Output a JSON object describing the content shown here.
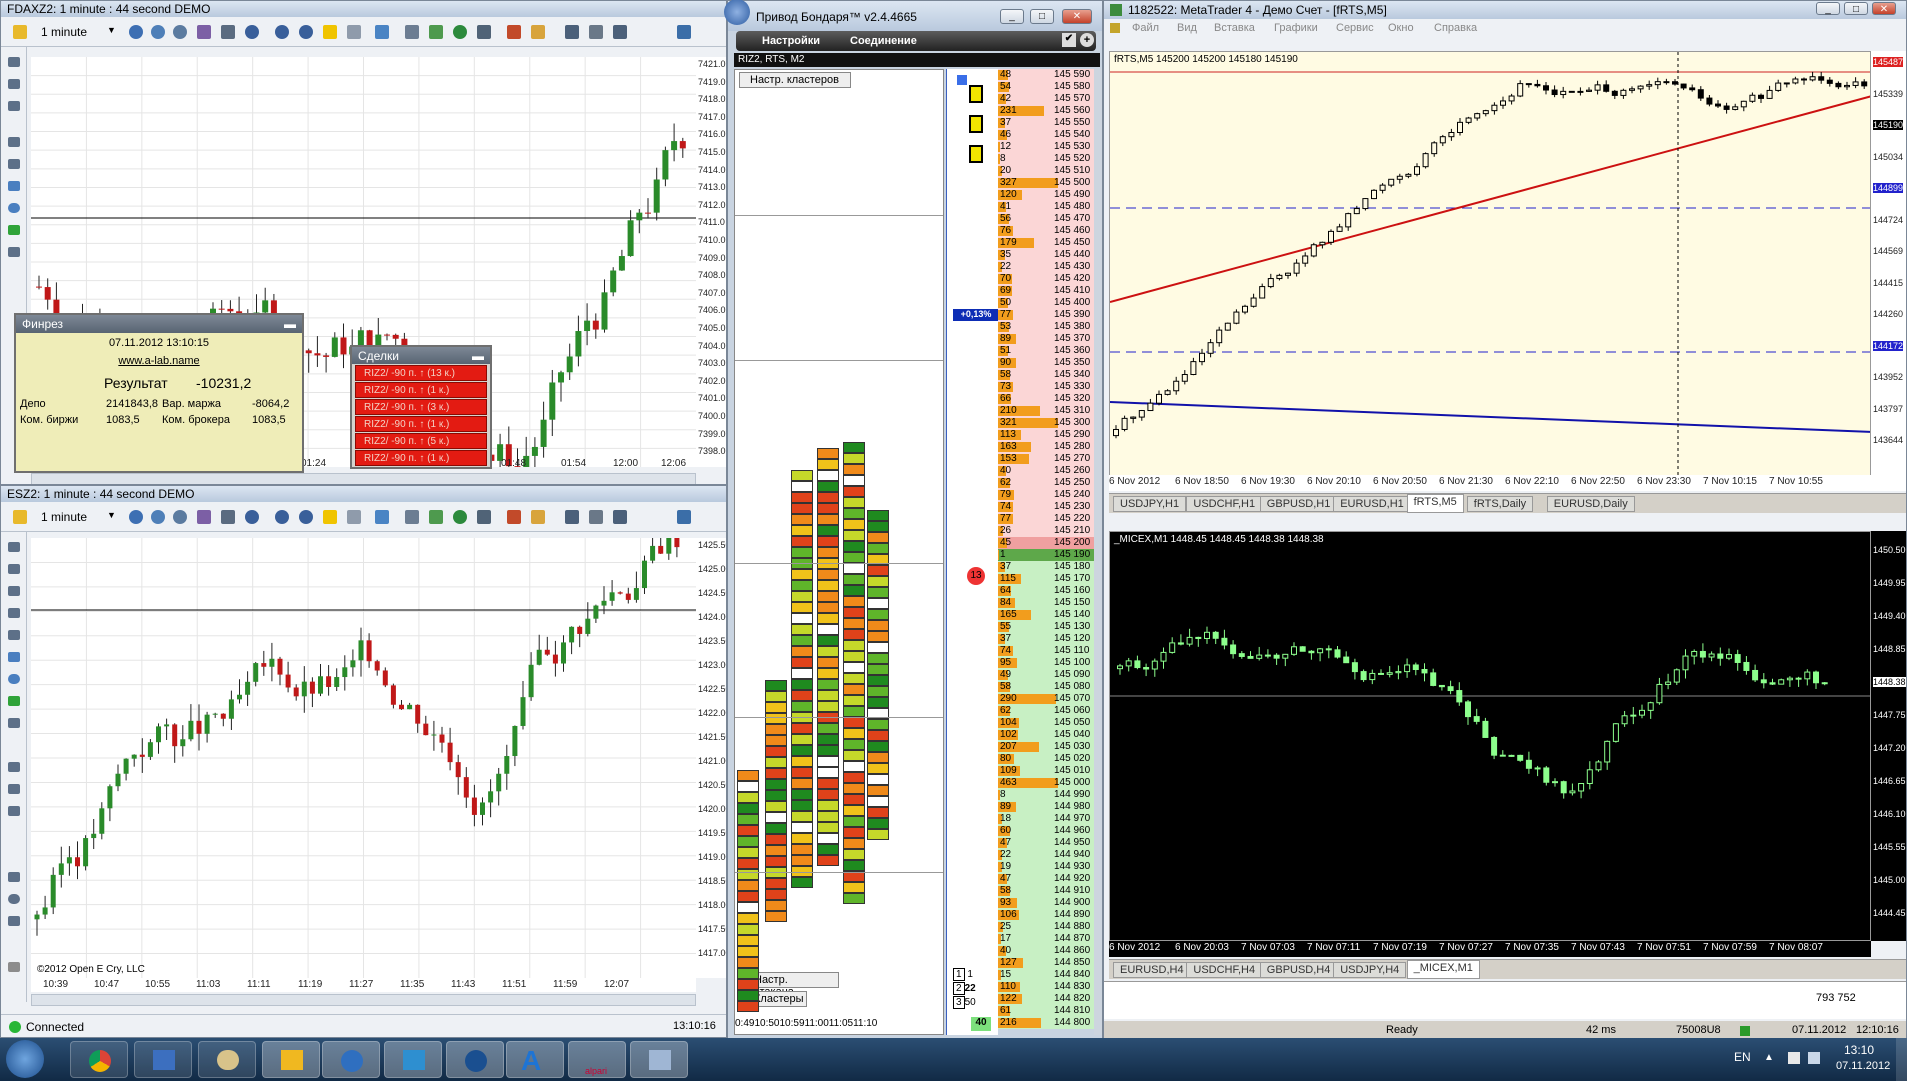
{
  "fdax": {
    "title": "FDAXZ2: 1 minute : 44 second DEMO",
    "timeframe": "1 minute",
    "prices": [
      "7421.0",
      "7419.0",
      "7418.0",
      "7417.0",
      "7416.0",
      "7415.0",
      "7414.0",
      "7413.0",
      "7412.0",
      "7411.0",
      "7410.0",
      "7409.0",
      "7408.0",
      "7407.0",
      "7406.0",
      "7405.0",
      "7404.0",
      "7403.0",
      "7402.0",
      "7401.0",
      "7400.0",
      "7399.0",
      "7398.0"
    ],
    "times": [
      "01:24",
      "01:48",
      "01:54",
      "12:00",
      "12:06"
    ],
    "last": "7412.0"
  },
  "fin": {
    "title": "Финрез",
    "date": "07.11.2012 13:10:15",
    "site": "www.a-lab.name",
    "result_label": "Результат",
    "result_value": "-10231,2",
    "depo_label": "Депо",
    "depo_value": "2141843,8",
    "margin_label": "Вар. маржа",
    "margin_value": "-8064,2",
    "exch_label": "Ком. биржи",
    "exch_value": "1083,5",
    "broker_label": "Ком. брокера",
    "broker_value": "1083,5"
  },
  "deals": {
    "title": "Сделки",
    "rows": [
      "RIZ2/ -90 п. ↑ (13 к.)",
      "RIZ2/ -90 п. ↑ (1 к.)",
      "RIZ2/ -90 п. ↑ (3 к.)",
      "RIZ2/ -90 п. ↑ (1 к.)",
      "RIZ2/ -90 п. ↑ (5 к.)",
      "RIZ2/ -90 п. ↑ (1 к.)"
    ]
  },
  "es": {
    "title": "ESZ2: 1 minute : 44 second DEMO",
    "timeframe": "1 minute",
    "prices": [
      "1425.50",
      "1425.00",
      "1424.50",
      "1424.00",
      "1423.50",
      "1423.00",
      "1422.50",
      "1422.00",
      "1421.50",
      "1421.00",
      "1420.50",
      "1420.00",
      "1419.50",
      "1419.00",
      "1418.50",
      "1418.00",
      "1417.50",
      "1417.00"
    ],
    "times": [
      "10:39",
      "10:47",
      "10:55",
      "11:03",
      "11:11",
      "11:19",
      "11:27",
      "11:35",
      "11:43",
      "11:51",
      "11:59",
      "12:07"
    ],
    "last": "1424.25",
    "copyright": "©2012 Open E Cry, LLC",
    "status": "Connected",
    "clock": "13:10:16"
  },
  "bond": {
    "title": "Привод Бондаря™ v2.4.4665",
    "menu": [
      "Настройки",
      "Соединение"
    ],
    "symbol": "RIZ2, RTS, M2",
    "btn_clusters_settings": "Настр. кластеров",
    "btn_book_settings": "Настр. стакана",
    "btn_clusters": "Кластеры",
    "pct": "+0,13%",
    "trades": "13",
    "legend": [
      [
        "1",
        "1"
      ],
      [
        "2",
        "22"
      ],
      [
        "3",
        "50"
      ]
    ],
    "legend_total": "40",
    "times": "0:4910:5010:5911:0011:0511:10",
    "book": [
      [
        "48",
        "145 590"
      ],
      [
        "54",
        "145 580"
      ],
      [
        "42",
        "145 570"
      ],
      [
        "231",
        "145 560"
      ],
      [
        "37",
        "145 550"
      ],
      [
        "46",
        "145 540"
      ],
      [
        "12",
        "145 530"
      ],
      [
        "8",
        "145 520"
      ],
      [
        "20",
        "145 510"
      ],
      [
        "327",
        "145 500"
      ],
      [
        "120",
        "145 490"
      ],
      [
        "41",
        "145 480"
      ],
      [
        "56",
        "145 470"
      ],
      [
        "76",
        "145 460"
      ],
      [
        "179",
        "145 450"
      ],
      [
        "35",
        "145 440"
      ],
      [
        "22",
        "145 430"
      ],
      [
        "70",
        "145 420"
      ],
      [
        "69",
        "145 410"
      ],
      [
        "50",
        "145 400"
      ],
      [
        "77",
        "145 390"
      ],
      [
        "53",
        "145 380"
      ],
      [
        "89",
        "145 370"
      ],
      [
        "51",
        "145 360"
      ],
      [
        "90",
        "145 350"
      ],
      [
        "58",
        "145 340"
      ],
      [
        "73",
        "145 330"
      ],
      [
        "66",
        "145 320"
      ],
      [
        "210",
        "145 310"
      ],
      [
        "321",
        "145 300"
      ],
      [
        "113",
        "145 290"
      ],
      [
        "163",
        "145 280"
      ],
      [
        "153",
        "145 270"
      ],
      [
        "40",
        "145 260"
      ],
      [
        "62",
        "145 250"
      ],
      [
        "79",
        "145 240"
      ],
      [
        "74",
        "145 230"
      ],
      [
        "77",
        "145 220"
      ],
      [
        "26",
        "145 210"
      ],
      [
        "45",
        "145 200"
      ],
      [
        "1",
        "145 190"
      ],
      [
        "37",
        "145 180"
      ],
      [
        "115",
        "145 170"
      ],
      [
        "64",
        "145 160"
      ],
      [
        "84",
        "145 150"
      ],
      [
        "165",
        "145 140"
      ],
      [
        "55",
        "145 130"
      ],
      [
        "37",
        "145 120"
      ],
      [
        "74",
        "145 110"
      ],
      [
        "95",
        "145 100"
      ],
      [
        "49",
        "145 090"
      ],
      [
        "58",
        "145 080"
      ],
      [
        "290",
        "145 070"
      ],
      [
        "62",
        "145 060"
      ],
      [
        "104",
        "145 050"
      ],
      [
        "102",
        "145 040"
      ],
      [
        "207",
        "145 030"
      ],
      [
        "80",
        "145 020"
      ],
      [
        "109",
        "145 010"
      ],
      [
        "463",
        "145 000"
      ],
      [
        "8",
        "144 990"
      ],
      [
        "89",
        "144 980"
      ],
      [
        "18",
        "144 970"
      ],
      [
        "60",
        "144 960"
      ],
      [
        "47",
        "144 950"
      ],
      [
        "22",
        "144 940"
      ],
      [
        "19",
        "144 930"
      ],
      [
        "47",
        "144 920"
      ],
      [
        "58",
        "144 910"
      ],
      [
        "93",
        "144 900"
      ],
      [
        "106",
        "144 890"
      ],
      [
        "25",
        "144 880"
      ],
      [
        "17",
        "144 870"
      ],
      [
        "40",
        "144 860"
      ],
      [
        "127",
        "144 850"
      ],
      [
        "15",
        "144 840"
      ],
      [
        "110",
        "144 830"
      ],
      [
        "122",
        "144 820"
      ],
      [
        "61",
        "144 810"
      ],
      [
        "216",
        "144 800"
      ]
    ]
  },
  "mt4": {
    "title": "1182522: MetaTrader 4 - Демо Счет - [fRTS,M5]",
    "menu": [
      "Файл",
      "Вид",
      "Вставка",
      "Графики",
      "Сервис",
      "Окно",
      "Справка"
    ],
    "chart1": {
      "info": "fRTS,M5  145200 145200 145180 145190",
      "prices": [
        "145487",
        "145339",
        "145190",
        "145034",
        "144899",
        "144724",
        "144569",
        "144415",
        "144260",
        "144172",
        "143952",
        "143797",
        "143644"
      ],
      "times": [
        "6 Nov 2012",
        "6 Nov 18:50",
        "6 Nov 19:30",
        "6 Nov 20:10",
        "6 Nov 20:50",
        "6 Nov 21:30",
        "6 Nov 22:10",
        "6 Nov 22:50",
        "6 Nov 23:30",
        "7 Nov 10:15",
        "7 Nov 10:55"
      ],
      "tabs": [
        "USDJPY,H1",
        "USDCHF,H1",
        "GBPUSD,H1",
        "EURUSD,H1",
        "fRTS,M5",
        "fRTS,Daily",
        "EURUSD,Daily"
      ],
      "active": "fRTS,M5"
    },
    "chart2": {
      "info": "_MICEX,M1  1448.45 1448.45 1448.38 1448.38",
      "prices": [
        "1450.50",
        "1449.95",
        "1449.40",
        "1448.85",
        "1448.38",
        "1447.75",
        "1447.20",
        "1446.65",
        "1446.10",
        "1445.55",
        "1445.00",
        "1444.45"
      ],
      "times": [
        "6 Nov 2012",
        "6 Nov 20:03",
        "7 Nov 07:03",
        "7 Nov 07:11",
        "7 Nov 07:19",
        "7 Nov 07:27",
        "7 Nov 07:35",
        "7 Nov 07:43",
        "7 Nov 07:51",
        "7 Nov 07:59",
        "7 Nov 08:07"
      ],
      "tabs": [
        "EURUSD,H4",
        "USDCHF,H4",
        "GBPUSD,H4",
        "USDJPY,H4",
        "_MICEX,M1"
      ],
      "active": "_MICEX,M1"
    },
    "status": {
      "ready": "Ready",
      "ping": "42 ms",
      "traffic": "75008U8",
      "date": "07.11.2012",
      "time": "12:10:16",
      "right_value": "793 752"
    }
  },
  "taskbar": {
    "lang": "EN",
    "time": "13:10",
    "date": "07.11.2012"
  }
}
